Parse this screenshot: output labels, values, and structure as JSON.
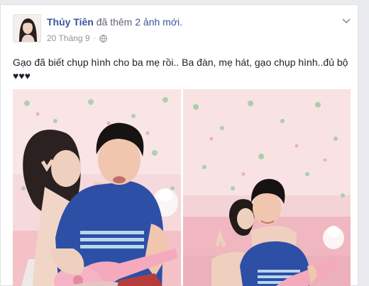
{
  "post": {
    "author": "Thủy Tiên",
    "action": "đã thêm",
    "photo_count_text": "2 ảnh mới.",
    "date": "20 Tháng 9",
    "separator": "·",
    "audience_icon": "globe-icon",
    "menu_icon": "chevron-down-icon",
    "text": "Gạo đã biết chụp hình cho ba mẹ rồi.. Ba đàn, mẹ hát, gạo chụp hình..đủ bộ ♥♥♥"
  },
  "colors": {
    "link": "#365899",
    "meta": "#90949c",
    "body_text": "#1d2129",
    "wall_pink": "#f4c9cf",
    "shirt_blue": "#2c4fa8",
    "ukulele_pink": "#f3a7bd"
  }
}
